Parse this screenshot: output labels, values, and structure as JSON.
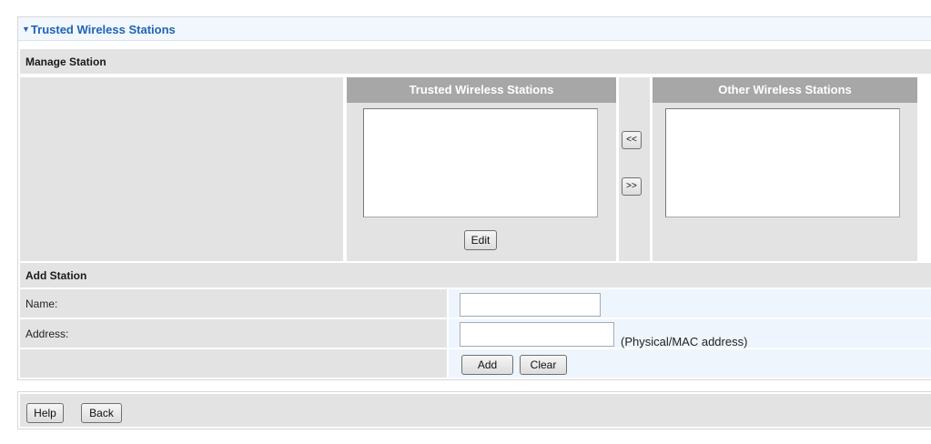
{
  "panel": {
    "title": "Trusted Wireless Stations",
    "title_arrow": "▼"
  },
  "manage": {
    "header": "Manage Station",
    "trusted_header": "Trusted Wireless Stations",
    "other_header": "Other Wireless Stations",
    "move_left_label": "<<",
    "move_right_label": ">>",
    "edit_label": "Edit"
  },
  "add": {
    "header": "Add Station",
    "name_label": "Name:",
    "name_value": "",
    "address_label": "Address:",
    "address_value": "",
    "address_hint": "(Physical/MAC address)",
    "add_label": "Add",
    "clear_label": "Clear"
  },
  "footer": {
    "help_label": "Help",
    "back_label": "Back"
  }
}
